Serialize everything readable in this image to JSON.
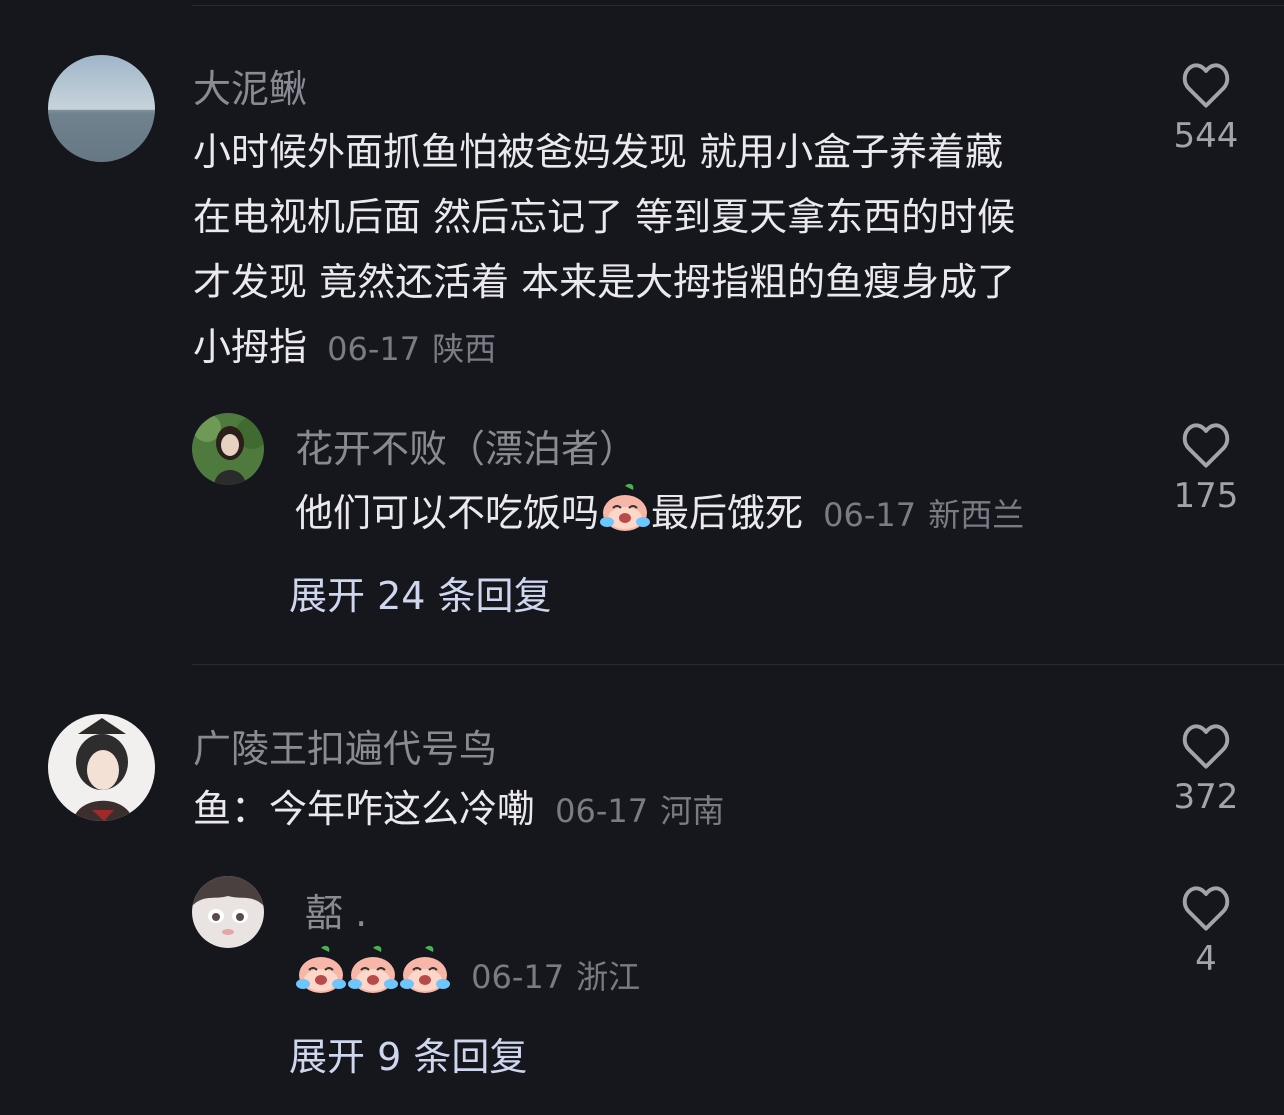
{
  "comments": [
    {
      "author": "大泥鳅",
      "lines": [
        "小时候外面抓鱼怕被爸妈发现 就用小盒子养着藏",
        "在电视机后面 然后忘记了 等到夏天拿东西的时候",
        "才发现 竟然还活着 本来是大拇指粗的鱼瘦身成了",
        "小拇指"
      ],
      "date": "06-17",
      "region": "陕西",
      "likes": "544",
      "avatar_icon": "sea-landscape-avatar"
    },
    {
      "author": "花开不败（漂泊者）",
      "text_before": "他们可以不吃饭吗",
      "text_after": "最后饿死",
      "emoji_icon": "crying-face-emoji",
      "date": "06-17",
      "region": "新西兰",
      "likes": "175",
      "avatar_icon": "girl-portrait-avatar"
    },
    {
      "author": "广陵王扣遍代号鸟",
      "text": "鱼：今年咋这么冷嘞",
      "date": "06-17",
      "region": "河南",
      "likes": "372",
      "avatar_icon": "anime-character-avatar"
    },
    {
      "author": "嚭 .",
      "emoji_icon": "crying-face-emoji",
      "emoji_count": 3,
      "date": "06-17",
      "region": "浙江",
      "likes": "4",
      "avatar_icon": "anime-face-avatar"
    }
  ],
  "expand_replies": [
    "展开 24 条回复",
    "展开 9 条回复"
  ],
  "colors": {
    "background": "#16161d",
    "name": "#8a8a93",
    "body_text": "#e9e9ee",
    "meta": "#7b7b84",
    "expand": "#cfd7ee"
  }
}
